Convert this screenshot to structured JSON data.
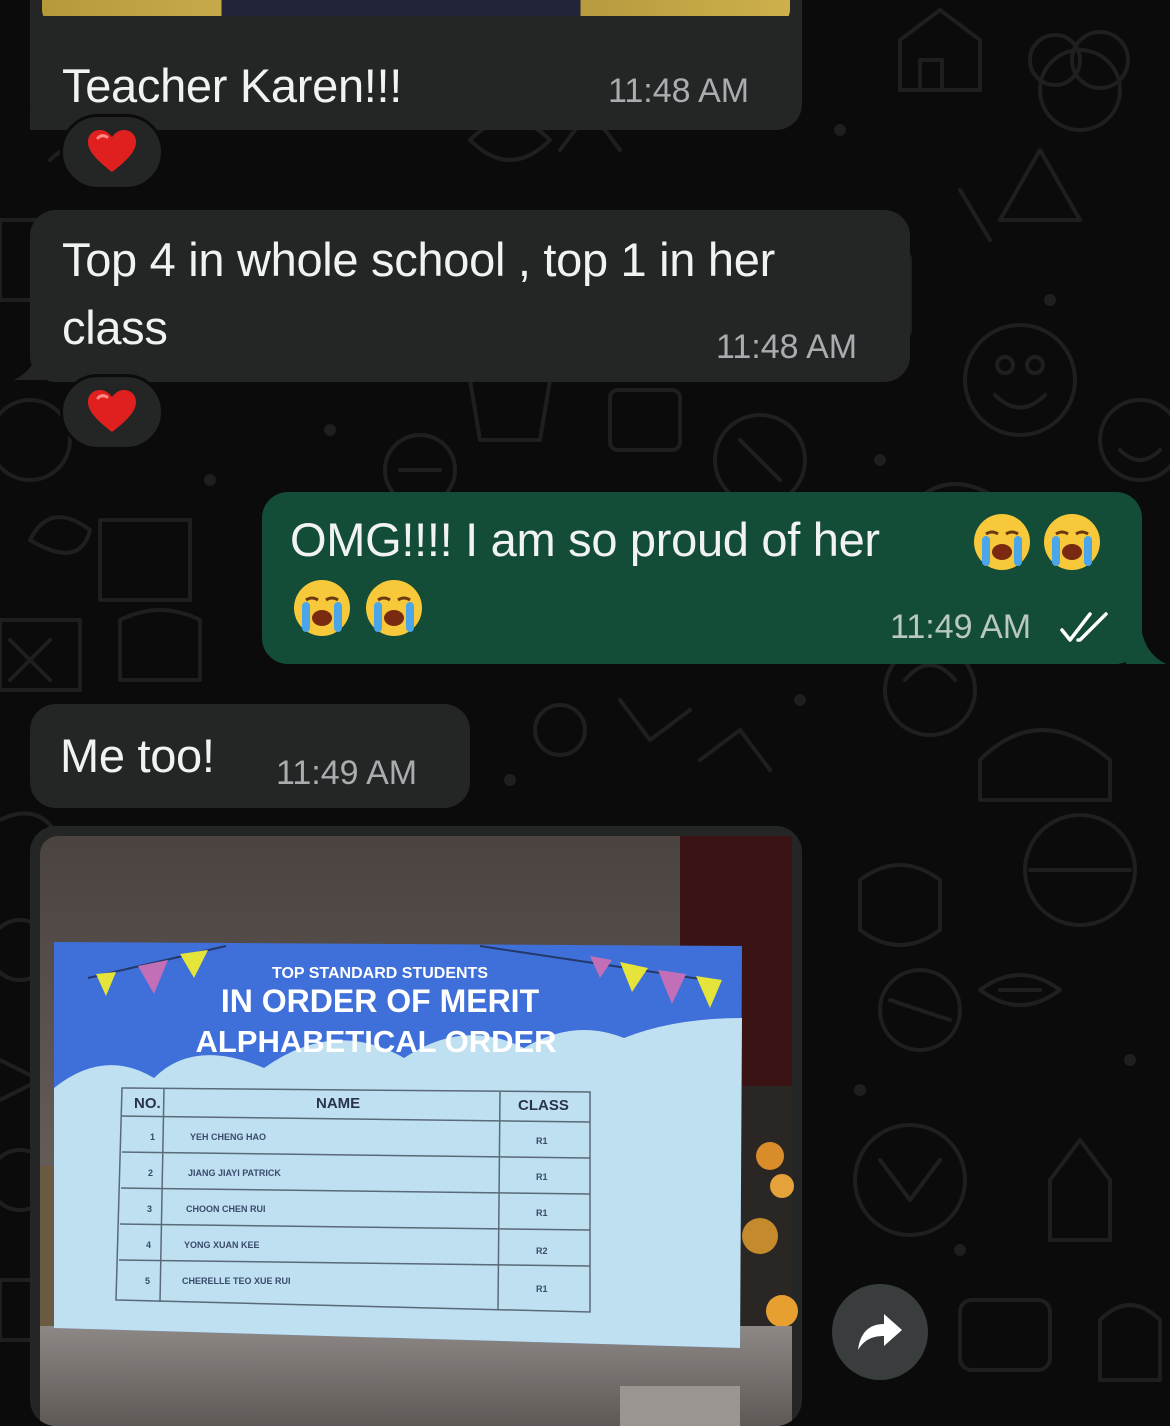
{
  "messages": [
    {
      "text": "Teacher Karen!!!",
      "time": "11:48 AM",
      "reaction": "red-heart"
    },
    {
      "line1": "Top 4 in whole school , top 1 in her",
      "line2": "class",
      "time": "11:48 AM",
      "reaction": "red-heart"
    },
    {
      "line1": "OMG!!!! I am so proud of her",
      "time": "11:49 AM",
      "status": "read"
    },
    {
      "text": "Me too!",
      "time": "11:49 AM"
    }
  ],
  "slide": {
    "heading1": "TOP STANDARD STUDENTS",
    "heading2": "IN ORDER OF MERIT",
    "heading3": "ALPHABETICAL ORDER",
    "columns": [
      "NO.",
      "NAME",
      "CLASS"
    ],
    "rows": [
      [
        "1",
        "YEH CHENG HAO",
        "R1"
      ],
      [
        "2",
        "JIANG JIAYI PATRICK",
        "R1"
      ],
      [
        "3",
        "CHOON CHEN RUI",
        "R1"
      ],
      [
        "4",
        "YONG XUAN KEE",
        "R2"
      ],
      [
        "5",
        "CHERELLE TEO XUE RUI",
        "R1"
      ]
    ]
  },
  "icons": {
    "reaction": "red-heart",
    "crying": "loudly-crying-face",
    "read_receipt": "double-check-icon",
    "forward": "forward-arrow-icon"
  },
  "colors": {
    "background": "#0b0b0b",
    "incoming_bubble": "#242626",
    "outgoing_bubble": "#144d37",
    "text": "#f0f2f3",
    "read_check": "#ffffff"
  }
}
